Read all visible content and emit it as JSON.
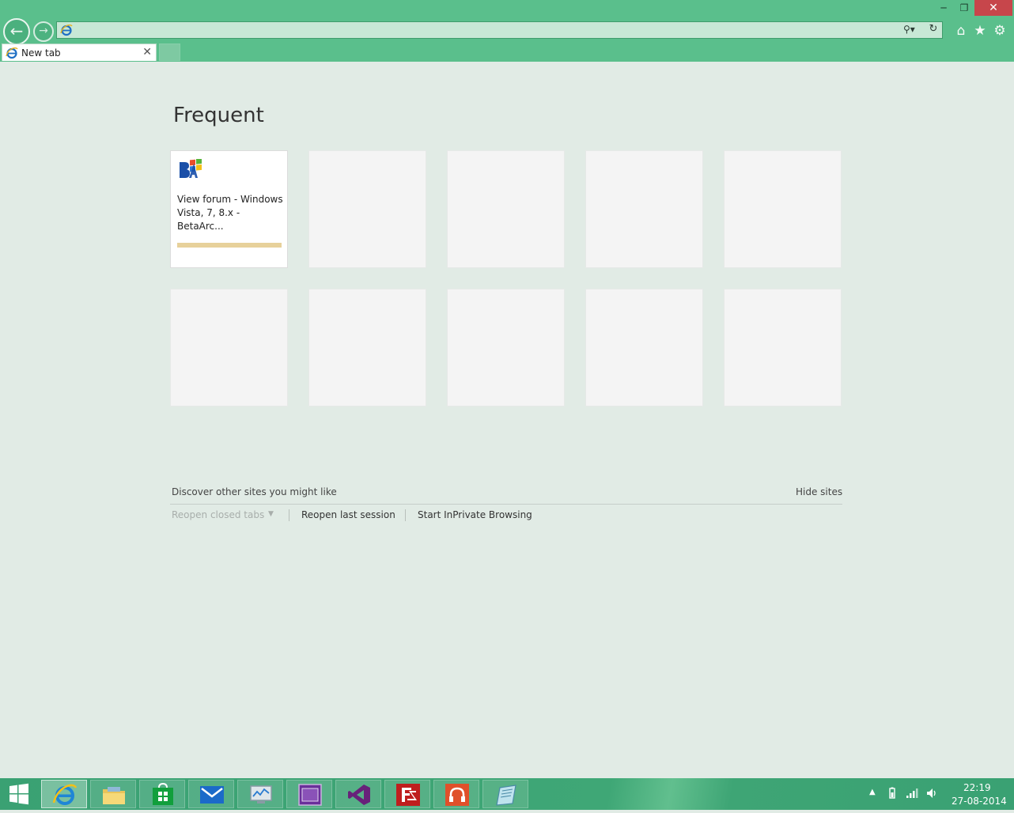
{
  "window": {
    "minimize_glyph": "─",
    "restore_glyph": "❐",
    "close_glyph": "✕"
  },
  "nav": {
    "back_glyph": "←",
    "forward_glyph": "→"
  },
  "address": {
    "value": "",
    "placeholder": "",
    "search_glyph": "⚲▾",
    "refresh_glyph": "↻"
  },
  "toolbar": {
    "home_glyph": "⌂",
    "favorites_glyph": "★",
    "tools_glyph": "⚙"
  },
  "tabs": [
    {
      "label": "New tab",
      "close_glyph": "✕"
    }
  ],
  "frequent": {
    "title": "Frequent",
    "tiles": [
      {
        "title": "View forum - Windows Vista, 7, 8.x - BetaArc...",
        "favicon": "betaarchive-icon"
      }
    ]
  },
  "discover": {
    "text": "Discover other sites you might like",
    "hide_label": "Hide sites"
  },
  "actions": {
    "reopen_closed_tabs": "Reopen closed tabs",
    "dropdown_glyph": "▼",
    "reopen_last_session": "Reopen last session",
    "start_inprivate": "Start InPrivate Browsing"
  },
  "taskbar": {
    "apps": [
      "internet-explorer",
      "file-explorer",
      "store",
      "mail",
      "performance-monitor",
      "cpu-z",
      "visual-studio",
      "filezilla",
      "music",
      "notepad"
    ],
    "tray_arrow": "▲",
    "time": "22:19",
    "date": "27-08-2014"
  },
  "colors": {
    "chrome": "#5abf8c",
    "close": "#c7464b",
    "page_background": "#e1ebe5",
    "taskbar": "#3aa173"
  }
}
